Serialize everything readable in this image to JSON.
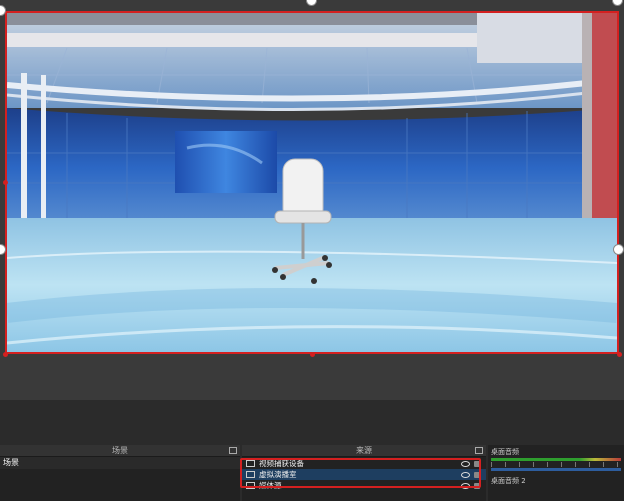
{
  "docks": {
    "scenes": {
      "title": "场景",
      "items": [
        "场景"
      ]
    },
    "sources": {
      "title": "来源",
      "items": [
        {
          "label": "视频捕获设备",
          "icon": "camera-icon"
        },
        {
          "label": "虚拟演播室",
          "icon": "image-icon"
        },
        {
          "label": "媒体源",
          "icon": "media-icon"
        }
      ]
    },
    "mixer": {
      "items": [
        "桌面音频",
        "桌面音频 2"
      ]
    }
  },
  "colors": {
    "selection_border": "#d42020",
    "selected_row": "#1e3e60",
    "dock_bg": "#222222"
  }
}
